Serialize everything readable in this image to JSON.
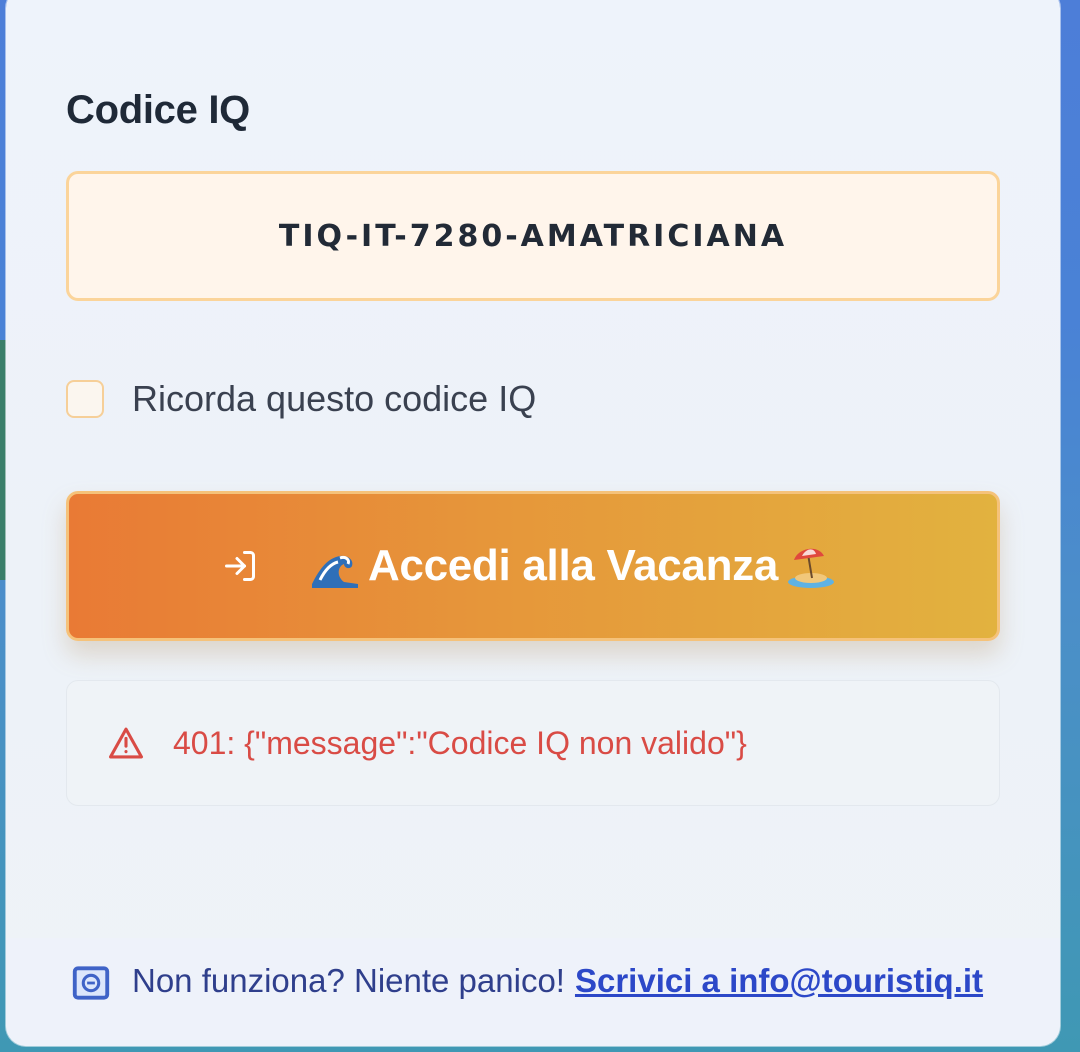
{
  "form": {
    "code_label": "Codice IQ",
    "code_value": "TIQ-IT-7280-AMATRICIANA",
    "remember_label": "Ricorda questo codice IQ",
    "remember_checked": false,
    "submit_label": "Accedi alla Vacanza",
    "submit_icons": [
      "login-icon",
      "wave-emoji",
      "beach-umbrella-emoji"
    ]
  },
  "error": {
    "icon": "warning-icon",
    "message": "401: {\"message\":\"Codice IQ non valido\"}"
  },
  "footer": {
    "icon": "mail-icon",
    "text": "Non funziona? Niente panico!",
    "link_text": "Scrivici a info@touristiq.it"
  },
  "colors": {
    "accent_orange": "#e97a35",
    "accent_yellow": "#e2b23f",
    "error_red": "#d94b45",
    "link_blue": "#2c48c8"
  }
}
